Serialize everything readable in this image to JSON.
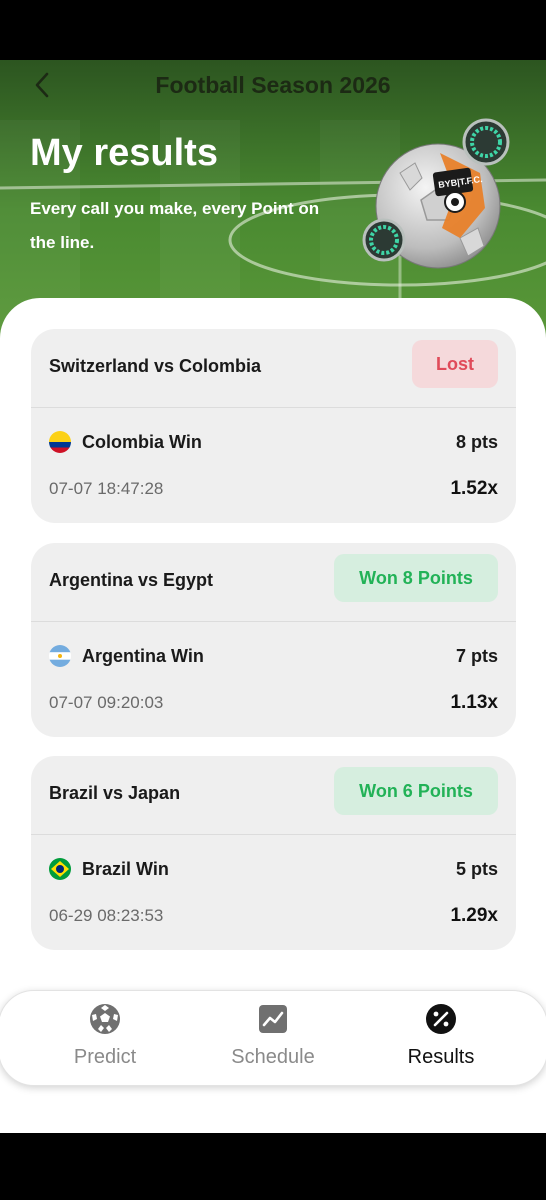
{
  "header": {
    "title": "Football Season 2026",
    "heading": "My results",
    "subtitle": "Every call you make, every Point on the line."
  },
  "results": [
    {
      "match": "Switzerland vs Colombia",
      "status": "Lost",
      "status_type": "lost",
      "pick": "Colombia Win",
      "flag": "colombia-flag",
      "points": "8 pts",
      "time": "07-07 18:47:28",
      "odds": "1.52x"
    },
    {
      "match": "Argentina vs Egypt",
      "status": "Won 8 Points",
      "status_type": "won",
      "pick": "Argentina Win",
      "flag": "argentina-flag",
      "points": "7 pts",
      "time": "07-07 09:20:03",
      "odds": "1.13x"
    },
    {
      "match": "Brazil vs Japan",
      "status": "Won 6 Points",
      "status_type": "won",
      "pick": "Brazil Win",
      "flag": "brazil-flag",
      "points": "5 pts",
      "time": "06-29 08:23:53",
      "odds": "1.29x"
    }
  ],
  "nav": {
    "items": [
      {
        "label": "Predict",
        "icon": "soccer-ball-icon",
        "active": false
      },
      {
        "label": "Schedule",
        "icon": "chart-icon",
        "active": false
      },
      {
        "label": "Results",
        "icon": "percent-icon",
        "active": true
      }
    ]
  },
  "colors": {
    "lost_bg": "#f5d9db",
    "lost_text": "#e04b5a",
    "won_bg": "#d6eedf",
    "won_text": "#22b257"
  }
}
